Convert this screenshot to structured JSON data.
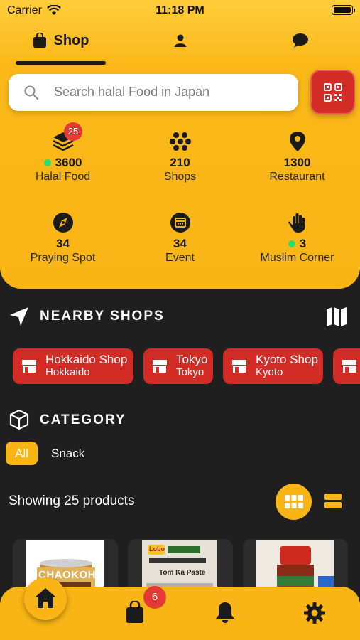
{
  "status_bar": {
    "carrier": "Carrier",
    "time": "11:18 PM"
  },
  "tabs": [
    {
      "label": "Shop",
      "icon": "shopping-bag-icon",
      "active": true
    },
    {
      "label": "",
      "icon": "person-icon",
      "active": false
    },
    {
      "label": "",
      "icon": "chat-bubble-icon",
      "active": false
    }
  ],
  "search": {
    "placeholder": "Search halal Food in Japan"
  },
  "stats": [
    {
      "value": "3600",
      "label": "Halal Food",
      "icon": "stack-icon",
      "badge": "25",
      "online_dot": true
    },
    {
      "value": "210",
      "label": "Shops",
      "icon": "dots-cluster-icon"
    },
    {
      "value": "1300",
      "label": "Restaurant",
      "icon": "location-pin-icon"
    },
    {
      "value": "34",
      "label": "Praying Spot",
      "icon": "compass-icon"
    },
    {
      "value": "34",
      "label": "Event",
      "icon": "calendar-icon"
    },
    {
      "value": "3",
      "label": "Muslim Corner",
      "icon": "hand-icon",
      "online_dot": true
    }
  ],
  "nearby": {
    "title": "NEARBY SHOPS",
    "shops": [
      {
        "name": "Hokkaido Shop",
        "city": "Hokkaido"
      },
      {
        "name": "Tokyo",
        "city": "Tokyo"
      },
      {
        "name": "Kyoto Shop",
        "city": "Kyoto"
      }
    ]
  },
  "category": {
    "title": "CATEGORY",
    "filters": [
      "All",
      "Snack"
    ],
    "selected": "All"
  },
  "products": {
    "showing_text": "Showing 25 products",
    "view_mode": "grid",
    "items": [
      {
        "image_text": "CHAOKOH"
      },
      {
        "image_text": "Tom Ka Paste",
        "brand": "Lobo"
      },
      {
        "image_text": ""
      }
    ]
  },
  "bottom_nav": {
    "items": [
      "home-icon",
      "bag-icon",
      "bell-icon",
      "gear-icon"
    ],
    "cart_badge": "6"
  },
  "colors": {
    "accent": "#f9b515",
    "red": "#d32b25",
    "dark": "#1f1f1f",
    "green_dot": "#2fdc6a"
  }
}
